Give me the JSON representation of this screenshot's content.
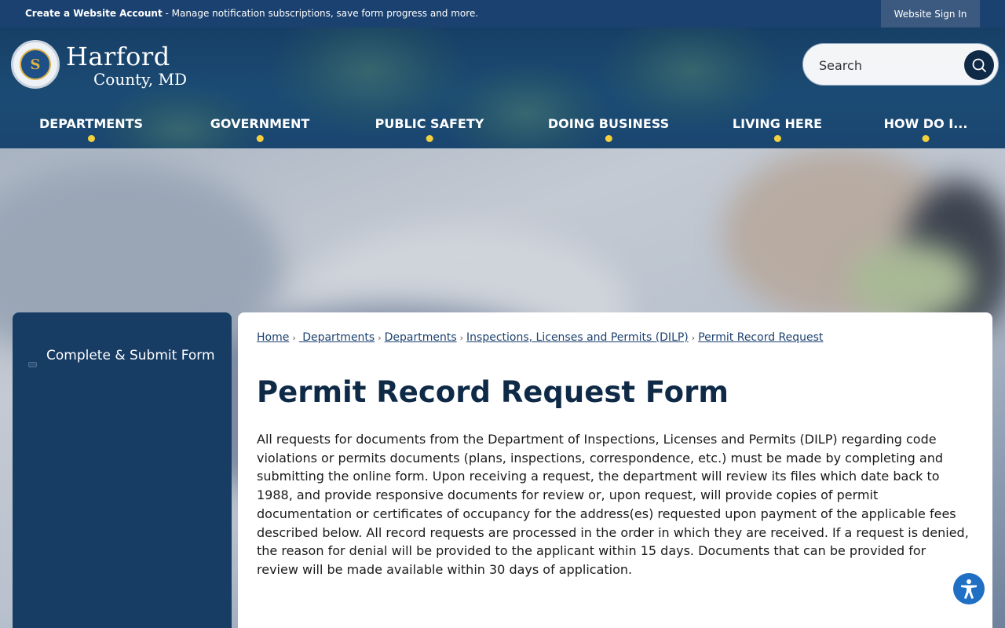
{
  "topbar": {
    "account_link": "Create a Website Account",
    "account_desc": " - Manage notification subscriptions, save form progress and more.",
    "signin": "Website Sign In"
  },
  "header": {
    "logo_line1": "Harford",
    "logo_line2": "County, MD",
    "seal_letter": "S",
    "search_placeholder": "Search"
  },
  "nav": {
    "items": [
      "DEPARTMENTS",
      "GOVERNMENT",
      "PUBLIC SAFETY",
      "DOING BUSINESS",
      "LIVING HERE",
      "HOW DO I..."
    ]
  },
  "sidebar": {
    "link": "Complete & Submit Form"
  },
  "breadcrumb": [
    "Home",
    " Departments",
    "Departments",
    "Inspections, Licenses and Permits (DILP)",
    "Permit Record Request"
  ],
  "page": {
    "title": "Permit Record Request Form",
    "intro": "All requests for documents from the Department of Inspections, Licenses and Permits (DILP) regarding code violations or permits documents (plans, inspections, correspondence, etc.) must be made by completing and submitting the online form. Upon receiving a request, the department will review its files which date back to 1988, and provide responsive documents for review or, upon request, will provide copies of permit documentation or certificates of occupancy for the address(es) requested upon payment of the applicable fees described below. All record requests are processed in the order in which they are received. If a request is denied, the reason for denial will be provided to the applicant within 15 days. Documents that can be provided for review will be made available within 30 days of application."
  },
  "colors": {
    "navy": "#183d65",
    "accent_dot": "#f4d03f",
    "link": "#1d4270",
    "accessibility": "#1f6fc4"
  },
  "icons": [
    "search-icon",
    "accessibility-icon",
    "county-seal-logo"
  ]
}
